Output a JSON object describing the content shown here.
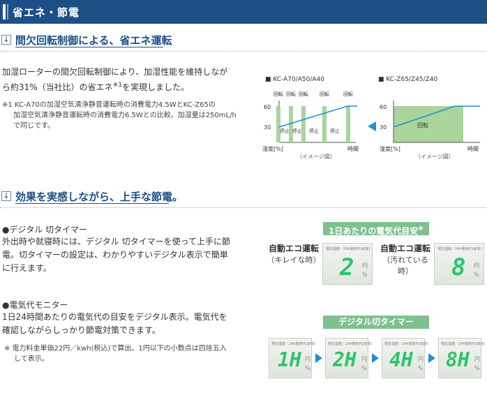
{
  "header": {
    "title": "省エネ・節電"
  },
  "section1": {
    "icon_glyph": "↓",
    "heading": "間欠回転制御による、省エネ運転",
    "body_line1": "加湿ローターの間欠回転制御により、加湿性能を維持しなが",
    "body_line2": "ら約31%（当社比）の省エネ",
    "body_sup": "※1",
    "body_line2b": "を実現しました。",
    "note_line1": "※1 KC-A70の加湿空気清浄静音運転時の消費電力4.5WとKC-Z65の",
    "note_line2": "加湿空気清浄静音運転時の消費電力6.5Wとの比較。加湿量は250mL/h",
    "note_line3": "で同じです。"
  },
  "chart_left": {
    "model": "■ KC-A70/A50/A40",
    "kaiten": "回転",
    "teishi": "停止",
    "y60": "60",
    "y30": "30",
    "ylabel": "湿度[%]",
    "xlabel": "時間",
    "caption": "（イメージ図）"
  },
  "chart_right": {
    "model": "■ KC-Z65/Z45/Z40",
    "kaiten": "回転",
    "y60": "60",
    "y30": "30",
    "ylabel": "湿度[%]",
    "xlabel": "時間",
    "caption": "（イメージ図）"
  },
  "section2": {
    "icon_glyph": "↓",
    "heading": "効果を実感しながら、上手な節電。",
    "timer_head": "●デジタル 切タイマー",
    "timer_line1": "外出時や就寝時には、デジタル 切タイマーを使って上手に節",
    "timer_line2": "電。切タイマーの設定は、わかりやすいデジタル表示で簡単",
    "timer_line3": "に行えます。",
    "monitor_head": "●電気代モニター",
    "monitor_line1": "1日24時間あたりの電気代の目安をデジタル表示。電気代を",
    "monitor_line2": "確認しながらしっかり節電対策できます。",
    "monitor_note1": "※  電力料金単価22円／kwh(税込)で算出。1円以下の小数点は四捨五入",
    "monitor_note2": "して表示。"
  },
  "cost_panel": {
    "title": "1日あたりの電気代目安",
    "title_sup": "※",
    "left_label": "自動エコ運転",
    "left_sub": "（キレイな時）",
    "left_value": "2",
    "right_label": "自動エコ運転",
    "right_sub": "（汚れている時）",
    "right_value": "8",
    "lcd_caption": "現在湿度／24h電気代(目安)",
    "unit_yen": "円",
    "unit_percent": "%"
  },
  "timer_panel": {
    "title": "デジタル切タイマー",
    "lcd_caption": "現在湿度／24h電気代(目安)",
    "values": [
      "1H",
      "2H",
      "4H",
      "8H"
    ],
    "unit_yen": "円",
    "unit_percent": "%"
  },
  "colors": {
    "header_bg": "#1c4f86",
    "heading": "#1c4f86",
    "bar_green": "#a9d49a",
    "line_blue": "#1e8fd8",
    "lcd_green": "#2ec46a",
    "panel_title_green": "#7ec08e"
  }
}
